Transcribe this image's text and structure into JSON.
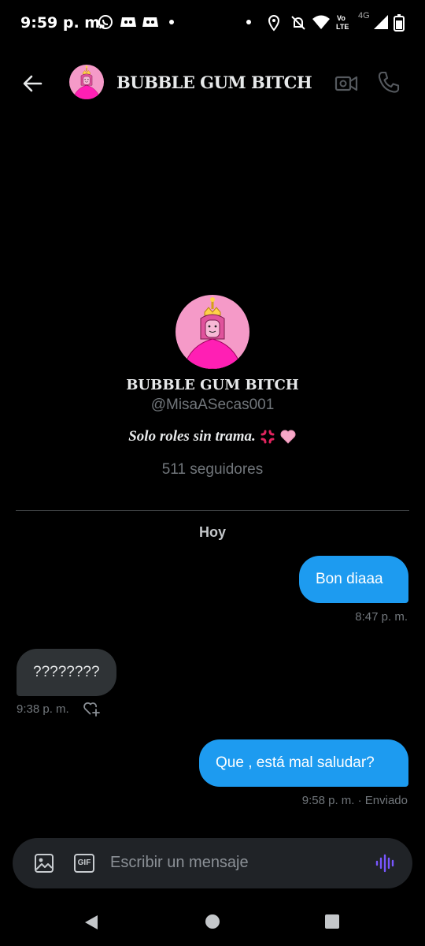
{
  "status_bar": {
    "time": "9:59 p. m.",
    "network": "4G"
  },
  "header": {
    "name": "BUBBLE GUM BITCH",
    "icons": [
      "back-arrow-icon",
      "video-call-icon",
      "phone-icon"
    ]
  },
  "profile": {
    "name": "BUBBLE GUM BITCH",
    "handle": "@MisaASecas001",
    "bio": "Solo roles sin trama.",
    "followers": "511 seguidores"
  },
  "conversation": {
    "day_label": "Hoy",
    "messages": [
      {
        "direction": "out",
        "text": "Bon diaaa",
        "time": "8:47 p. m."
      },
      {
        "direction": "in",
        "text": "????????",
        "time": "9:38 p. m."
      },
      {
        "direction": "out",
        "text": "Que , está mal saludar?",
        "time": "9:58 p. m. · Enviado"
      }
    ]
  },
  "composer": {
    "placeholder": "Escribir un mensaje",
    "gif_label": "GIF"
  },
  "colors": {
    "accent": "#1d9bf0",
    "incoming_bubble": "#2f3336",
    "background": "#000000",
    "voice": "#7856ff"
  }
}
